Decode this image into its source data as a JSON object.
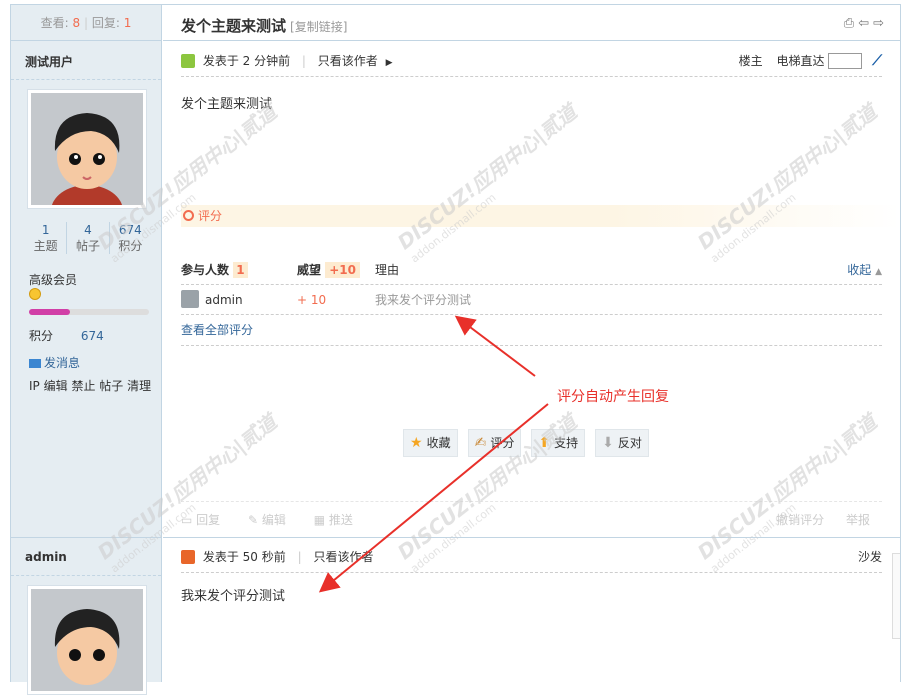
{
  "thread": {
    "views_label": "查看:",
    "views": "8",
    "replies_label": "回复:",
    "replies": "1",
    "title": "发个主题来测试",
    "copy_link": "[复制链接]"
  },
  "post1": {
    "author": "测试用户",
    "stats": [
      {
        "value": "1",
        "label": "主题"
      },
      {
        "value": "4",
        "label": "帖子"
      },
      {
        "value": "674",
        "label": "积分"
      }
    ],
    "group": "高级会员",
    "credits_label": "积分",
    "credits": "674",
    "send_msg": "发消息",
    "admin_links": [
      "IP",
      "编辑",
      "禁止",
      "帖子",
      "清理"
    ],
    "posted": "发表于 2 分钟前",
    "only_author": "只看该作者",
    "floor": "楼主",
    "elevator": "电梯直达",
    "content": "发个主题来测试",
    "rate_label": "评分",
    "rate_table": {
      "participants_label": "参与人数",
      "participants": "1",
      "score_label": "威望",
      "score_total": "+10",
      "reason_label": "理由",
      "collapse": "收起",
      "rows": [
        {
          "user": "admin",
          "score": "+ 10",
          "reason": "我来发个评分测试"
        }
      ],
      "view_all": "查看全部评分"
    },
    "actions": [
      {
        "icon": "star-icon",
        "label": "收藏"
      },
      {
        "icon": "rate-hand-icon",
        "label": "评分"
      },
      {
        "icon": "up-arrow-icon",
        "label": "支持"
      },
      {
        "icon": "down-arrow-icon",
        "label": "反对"
      }
    ],
    "footer_left": [
      "回复",
      "编辑",
      "推送"
    ],
    "footer_right": [
      "撤销评分",
      "举报"
    ]
  },
  "post2": {
    "author": "admin",
    "posted": "发表于 50 秒前",
    "only_author": "只看该作者",
    "floor": "沙发",
    "content": "我来发个评分测试"
  },
  "annotation": "评分自动产生回复",
  "watermark": {
    "main": "DISCUZ!应用中心|贰道",
    "sub": "addon.dismall.com"
  },
  "colors": {
    "accent": "#f26c4f",
    "link": "#336699",
    "sidebar": "#e5edf2",
    "arrow": "#e8302a"
  }
}
